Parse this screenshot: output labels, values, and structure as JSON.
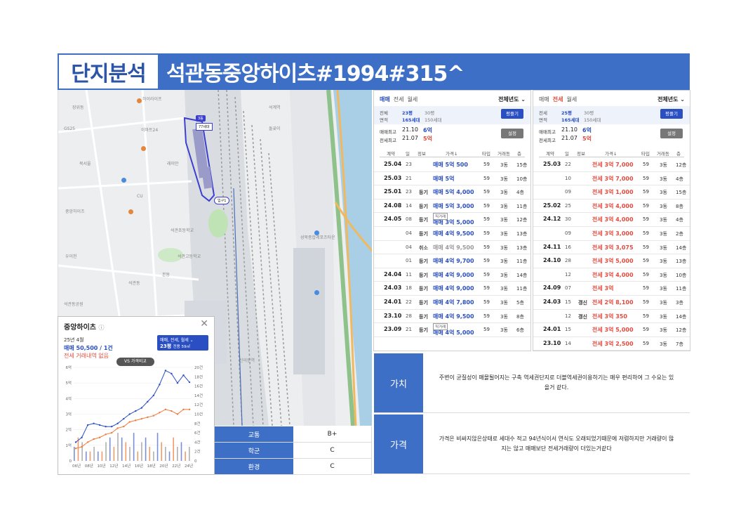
{
  "header": {
    "tag": "단지분석",
    "title": "석관동중앙하이츠#1994#315^"
  },
  "map": {
    "labels": [
      "하이라이프",
      "래미안",
      "석관초등학교",
      "석계역",
      "돌곶이",
      "장위동",
      "북서울",
      "CU",
      "GS25",
      "이마트24",
      "중앙하이츠",
      "3동",
      "77세대",
      "입구1",
      "성북종합레포츠타운",
      "석관동공원",
      "석관고등학교",
      "신이문역",
      "우이천",
      "석관동",
      "본동"
    ],
    "building_badge": "3동",
    "units_badge": "77세대",
    "entrance": "입구1"
  },
  "popup": {
    "title": "중앙하이츠",
    "title_badge": "ⓘ",
    "close": "✕",
    "month": "25년 4월",
    "sale": "매매 50,500 / 1건",
    "rent": "전세 거래내역 없음",
    "filter_line1": "매매, 전세, 월세 ⌄",
    "filter_line2": "23평",
    "filter_line3": "전용 59㎡",
    "vs": "VS 가격비교"
  },
  "chart_data": {
    "type": "line",
    "x": [
      "06년",
      "08년",
      "10년",
      "12년",
      "14년",
      "16년",
      "18년",
      "20년",
      "22년",
      "24년"
    ],
    "yleft_ticks": [
      "0",
      "1억",
      "2억",
      "3억",
      "4억",
      "5억",
      "6억"
    ],
    "yright_ticks": [
      "0",
      "2건",
      "4건",
      "6건",
      "8건",
      "10건",
      "12건",
      "14건",
      "16건",
      "18건",
      "20건"
    ],
    "ylim": [
      0,
      6
    ],
    "series": [
      {
        "name": "매매",
        "color": "#2a4fc2",
        "values": [
          1.2,
          1.5,
          2.3,
          2.4,
          2.3,
          2.2,
          2.2,
          2.4,
          2.7,
          3.0,
          3.2,
          3.4,
          3.8,
          4.2,
          4.9,
          5.8,
          5.6,
          5.0,
          5.5,
          5.05
        ]
      },
      {
        "name": "전세",
        "color": "#f07a3a",
        "values": [
          0.8,
          0.9,
          1.2,
          1.4,
          1.5,
          1.7,
          1.8,
          2.1,
          2.2,
          2.5,
          2.6,
          2.7,
          2.8,
          2.9,
          3.1,
          3.3,
          3.2,
          3.0,
          3.3,
          3.3
        ]
      }
    ],
    "volume": [
      3,
      5,
      4,
      2,
      2,
      3,
      2,
      2,
      4,
      5,
      3,
      6,
      5,
      4,
      3,
      6,
      2,
      4,
      5,
      3,
      2,
      6,
      4,
      3,
      2,
      5,
      3,
      4,
      2,
      3
    ]
  },
  "evaluation": [
    {
      "key": "교통",
      "value": "B+"
    },
    {
      "key": "학군",
      "value": "C"
    },
    {
      "key": "환경",
      "value": "C"
    }
  ],
  "descriptions": [
    {
      "key": "가치",
      "text": "주변이 균질성이 매몰될어지는 구축 역세권단지로 더블역세권이용하기는 매우 편리하여 그 수요는 있을거 같다."
    },
    {
      "key": "가격",
      "text": "가격은 비싸지않은상태로  세대수 적고 94년식이서 연식도 오래되었기때문에 저렴하지만  거래량이 많지는 않고 매매보단 전세거래량이 더있는거같다"
    }
  ],
  "sale_panel": {
    "tabs": [
      "매매",
      "전세",
      "월세"
    ],
    "year": "전체년도 ⌄",
    "info_label1": "전체",
    "info_val1": "23평",
    "info_alt1": "30평",
    "info_label2": "면적",
    "info_val2": "165세대",
    "info_alt2": "150세대",
    "button": "평플기",
    "max_label1": "매매최고",
    "max_date1": "21.10",
    "max_price1": "6억",
    "max_label2": "전세최고",
    "max_date2": "21.07",
    "max_price2": "5억",
    "setting": "설정",
    "columns": [
      "계약",
      "일",
      "정보",
      "가격↓",
      "타입",
      "거래동",
      "층"
    ],
    "rows": [
      {
        "ym": "25.04",
        "d": "23",
        "k": "",
        "p": "매매 5억 500",
        "t": "59",
        "s": "3동",
        "f": "15층",
        "c": "blue"
      },
      {
        "ym": "25.03",
        "d": "21",
        "k": "",
        "p": "매매 5억",
        "t": "59",
        "s": "3동",
        "f": "10층",
        "c": "blue"
      },
      {
        "ym": "25.01",
        "d": "23",
        "k": "등기",
        "p": "매매 5억 4,000",
        "t": "59",
        "s": "3동",
        "f": "4층",
        "c": "blue"
      },
      {
        "ym": "24.08",
        "d": "14",
        "k": "등기",
        "p": "매매 5억 3,000",
        "t": "59",
        "s": "3동",
        "f": "11층",
        "c": "blue"
      },
      {
        "ym": "24.05",
        "d": "08",
        "k": "등기",
        "p": "매매 3억 5,000",
        "t": "59",
        "s": "3동",
        "f": "12층",
        "c": "blue",
        "direct": "직거래"
      },
      {
        "ym": "",
        "d": "04",
        "k": "등기",
        "p": "매매 4억 9,500",
        "t": "59",
        "s": "3동",
        "f": "13층",
        "c": "blue"
      },
      {
        "ym": "",
        "d": "04",
        "k": "취소",
        "p": "매매 4억 9,500",
        "t": "59",
        "s": "3동",
        "f": "13층",
        "c": "gray"
      },
      {
        "ym": "",
        "d": "01",
        "k": "등기",
        "p": "매매 4억 9,700",
        "t": "59",
        "s": "3동",
        "f": "11층",
        "c": "blue"
      },
      {
        "ym": "24.04",
        "d": "11",
        "k": "등기",
        "p": "매매 4억 9,000",
        "t": "59",
        "s": "3동",
        "f": "14층",
        "c": "blue"
      },
      {
        "ym": "24.03",
        "d": "18",
        "k": "등기",
        "p": "매매 4억 9,000",
        "t": "59",
        "s": "3동",
        "f": "11층",
        "c": "blue"
      },
      {
        "ym": "24.01",
        "d": "22",
        "k": "등기",
        "p": "매매 4억 7,800",
        "t": "59",
        "s": "3동",
        "f": "5층",
        "c": "blue"
      },
      {
        "ym": "23.10",
        "d": "28",
        "k": "등기",
        "p": "매매 4억 9,500",
        "t": "59",
        "s": "3동",
        "f": "8층",
        "c": "blue"
      },
      {
        "ym": "23.09",
        "d": "21",
        "k": "등기",
        "p": "매매 4억 5,000",
        "t": "59",
        "s": "3동",
        "f": "6층",
        "c": "blue",
        "direct": "직거래"
      }
    ]
  },
  "rent_panel": {
    "tabs": [
      "매매",
      "전세",
      "월세"
    ],
    "year": "전체년도 ⌄",
    "info_label1": "전세",
    "info_val1": "25평",
    "info_alt1": "30평",
    "info_label2": "면적",
    "info_val2": "165세대",
    "info_alt2": "150세대",
    "button": "평플기",
    "max_label1": "매매최고",
    "max_date1": "21.10",
    "max_price1": "6억",
    "max_label2": "전세최고",
    "max_date2": "21.07",
    "max_price2": "5억",
    "setting": "설정",
    "columns": [
      "계약",
      "일",
      "정보",
      "가격↓",
      "타입",
      "거래동",
      "층"
    ],
    "rows": [
      {
        "ym": "25.03",
        "d": "22",
        "k": "",
        "p": "전세 3억 7,000",
        "t": "59",
        "s": "3동",
        "f": "12층",
        "c": "red"
      },
      {
        "ym": "",
        "d": "10",
        "k": "",
        "p": "전세 3억 7,000",
        "t": "59",
        "s": "3동",
        "f": "4층",
        "c": "red"
      },
      {
        "ym": "",
        "d": "09",
        "k": "",
        "p": "전세 3억 1,000",
        "t": "59",
        "s": "3동",
        "f": "15층",
        "c": "red"
      },
      {
        "ym": "25.02",
        "d": "25",
        "k": "",
        "p": "전세 3억 4,000",
        "t": "59",
        "s": "3동",
        "f": "8층",
        "c": "red"
      },
      {
        "ym": "24.12",
        "d": "30",
        "k": "",
        "p": "전세 3억 4,000",
        "t": "59",
        "s": "3동",
        "f": "4층",
        "c": "red"
      },
      {
        "ym": "",
        "d": "09",
        "k": "",
        "p": "전세 3억 3,000",
        "t": "59",
        "s": "3동",
        "f": "2층",
        "c": "red"
      },
      {
        "ym": "24.11",
        "d": "16",
        "k": "",
        "p": "전세 3억 3,075",
        "t": "59",
        "s": "3동",
        "f": "14층",
        "c": "red"
      },
      {
        "ym": "24.10",
        "d": "28",
        "k": "",
        "p": "전세 3억 5,000",
        "t": "59",
        "s": "3동",
        "f": "13층",
        "c": "red"
      },
      {
        "ym": "",
        "d": "12",
        "k": "",
        "p": "전세 3억 4,000",
        "t": "59",
        "s": "3동",
        "f": "10층",
        "c": "red"
      },
      {
        "ym": "24.09",
        "d": "07",
        "k": "",
        "p": "전세 3억",
        "t": "59",
        "s": "3동",
        "f": "11층",
        "c": "red"
      },
      {
        "ym": "24.03",
        "d": "15",
        "k": "갱신",
        "p": "전세 2억 8,100",
        "t": "59",
        "s": "3동",
        "f": "3층",
        "c": "red"
      },
      {
        "ym": "",
        "d": "12",
        "k": "갱신",
        "p": "전세 3억 350",
        "t": "59",
        "s": "3동",
        "f": "14층",
        "c": "red"
      },
      {
        "ym": "24.01",
        "d": "15",
        "k": "",
        "p": "전세 3억 5,000",
        "t": "59",
        "s": "3동",
        "f": "12층",
        "c": "red"
      },
      {
        "ym": "23.10",
        "d": "14",
        "k": "",
        "p": "전세 3억 2,500",
        "t": "59",
        "s": "3동",
        "f": "7층",
        "c": "red"
      }
    ]
  }
}
